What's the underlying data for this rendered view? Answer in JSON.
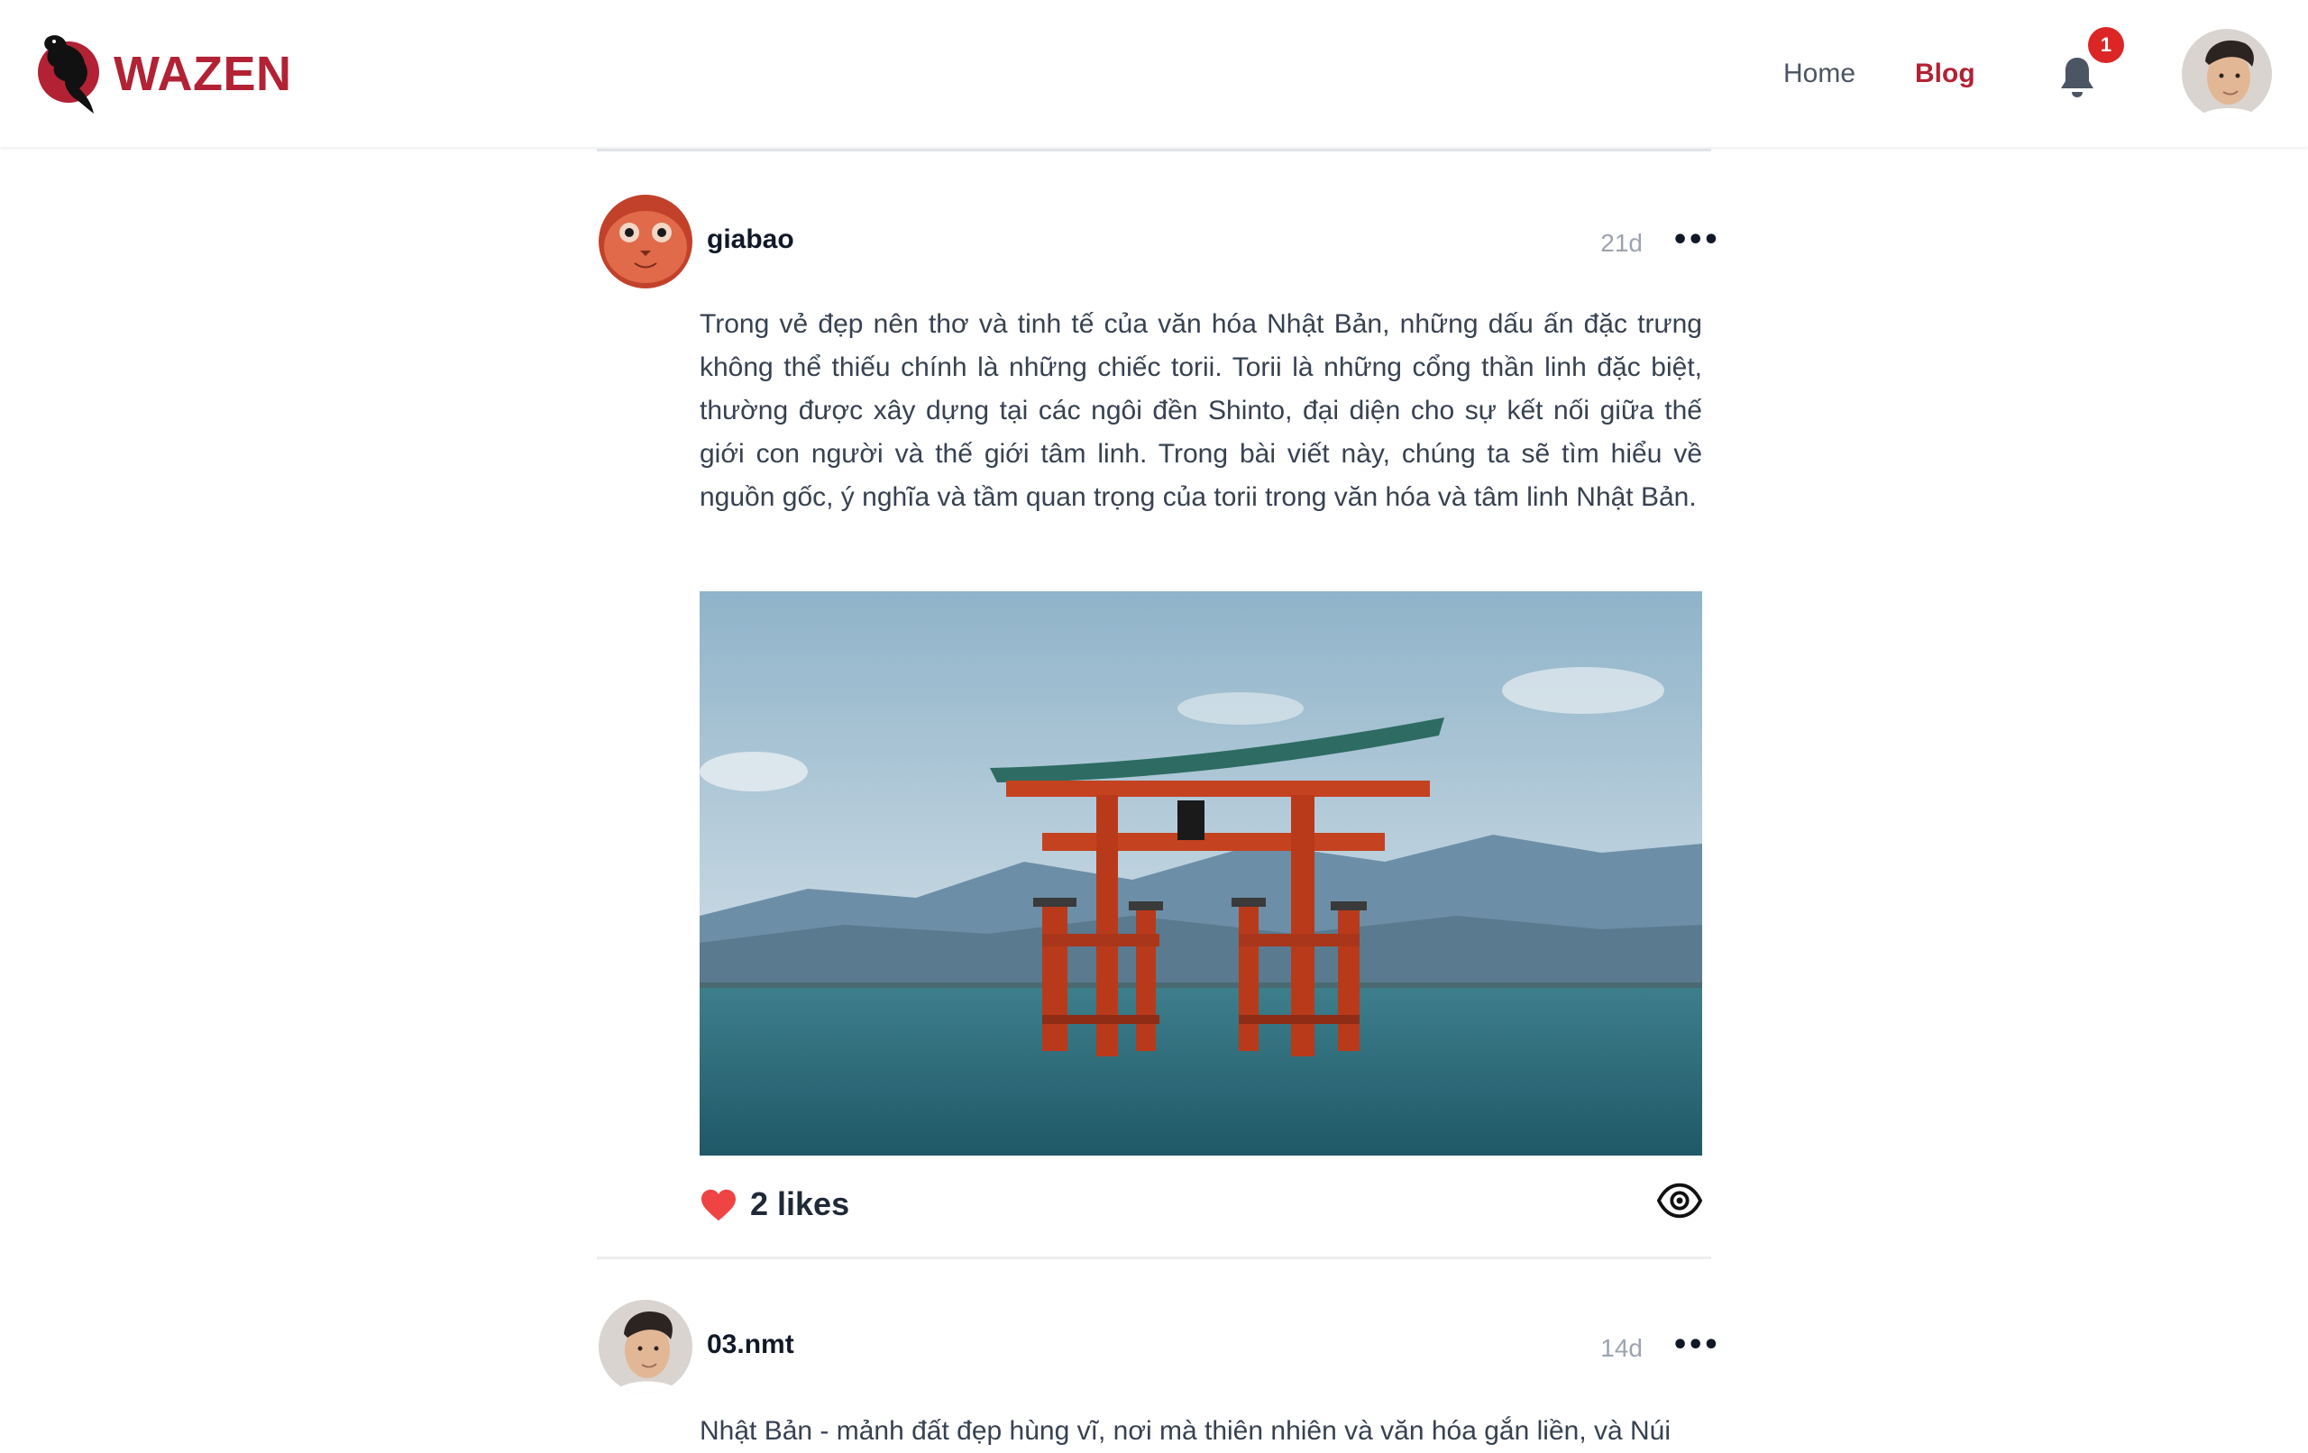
{
  "brand": {
    "name": "WAZEN",
    "color": "#b22234"
  },
  "nav": {
    "items": [
      {
        "label": "Home",
        "active": false
      },
      {
        "label": "Blog",
        "active": true
      }
    ]
  },
  "notifications": {
    "icon": "bell-icon",
    "count": "1"
  },
  "user": {
    "avatar": "user-avatar"
  },
  "posts": [
    {
      "username": "giabao",
      "time": "21d",
      "more": "•••",
      "body": "Trong vẻ đẹp nên thơ và tinh tế của văn hóa Nhật Bản, những dấu ấn đặc trưng không thể thiếu chính là những chiếc torii. Torii là những cổng thần linh đặc biệt, thường được xây dựng tại các ngôi đền Shinto, đại diện cho sự kết nối giữa thế giới con người và thế giới tâm linh. Trong bài viết này, chúng ta sẽ tìm hiểu về nguồn gốc, ý nghĩa và tầm quan trọng của torii trong văn hóa và tâm linh Nhật Bản.",
      "image": "torii-gate-in-sea-photo",
      "likes": "2 likes",
      "like_color": "#ef4444"
    },
    {
      "username": "03.nmt",
      "time": "14d",
      "more": "•••",
      "body": "Nhật Bản - mảnh đất đẹp hùng vĩ, nơi mà thiên nhiên và văn hóa gắn liền, và Núi"
    }
  ]
}
